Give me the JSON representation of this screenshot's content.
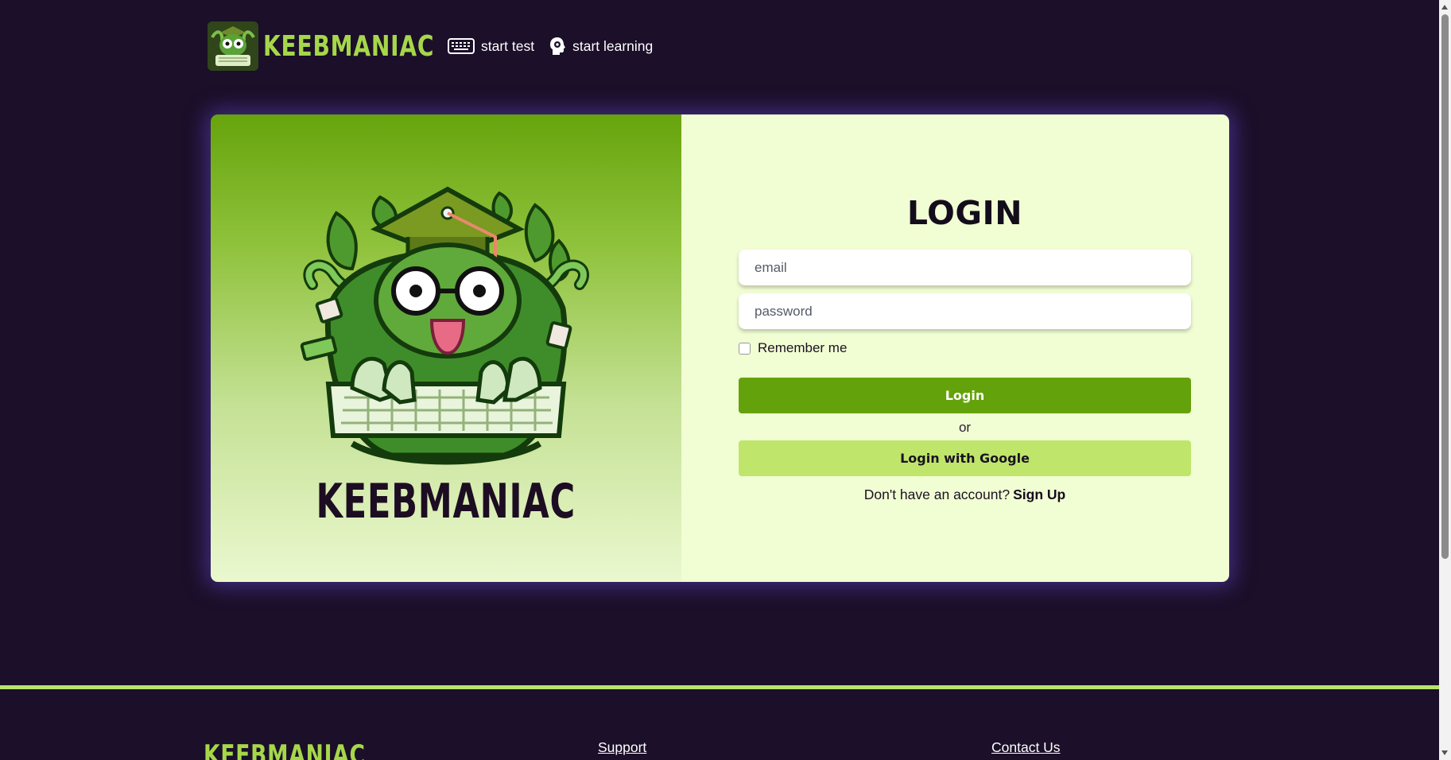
{
  "nav": {
    "brand": "KEEBMANIAC",
    "links": [
      {
        "label": "start test",
        "icon": "keyboard-icon"
      },
      {
        "label": "start learning",
        "icon": "brain-head-icon"
      }
    ]
  },
  "hero": {
    "brand": "KEEBMANIAC",
    "mascot": "keyboard-monster-mascot"
  },
  "login": {
    "title": "LOGIN",
    "email_placeholder": "email",
    "password_placeholder": "password",
    "remember_label": "Remember me",
    "login_button": "Login",
    "or_text": "or",
    "google_button": "Login with Google",
    "signup_prompt": "Don't have an account?",
    "signup_link": "Sign Up"
  },
  "footer": {
    "brand": "KEEBMANIAC",
    "support": "Support",
    "contact": "Contact Us"
  },
  "colors": {
    "background": "#1b0f29",
    "accent_green": "#64a20b",
    "light_green": "#bfe56b",
    "brand_green": "#a6d74a",
    "card_panel": "#f1fdd3"
  }
}
